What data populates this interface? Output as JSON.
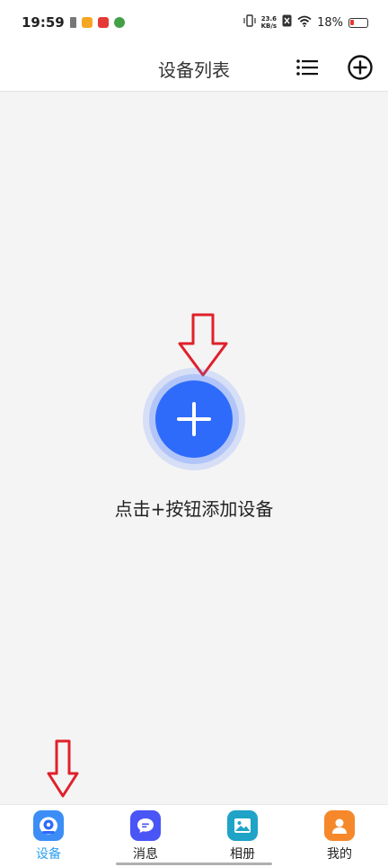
{
  "status_bar": {
    "time": "19:59",
    "net_speed_value": "23.6",
    "net_speed_unit": "KB/s",
    "battery": "18%"
  },
  "header": {
    "title": "设备列表"
  },
  "main": {
    "hint": "点击+按钮添加设备"
  },
  "tabbar": {
    "tabs": [
      {
        "label": "设备",
        "active": true
      },
      {
        "label": "消息"
      },
      {
        "label": "相册"
      },
      {
        "label": "我的"
      }
    ]
  },
  "colors": {
    "accent": "#2f6bfa",
    "arrow": "#e0202a",
    "active_tab": "#2aa0f0"
  }
}
